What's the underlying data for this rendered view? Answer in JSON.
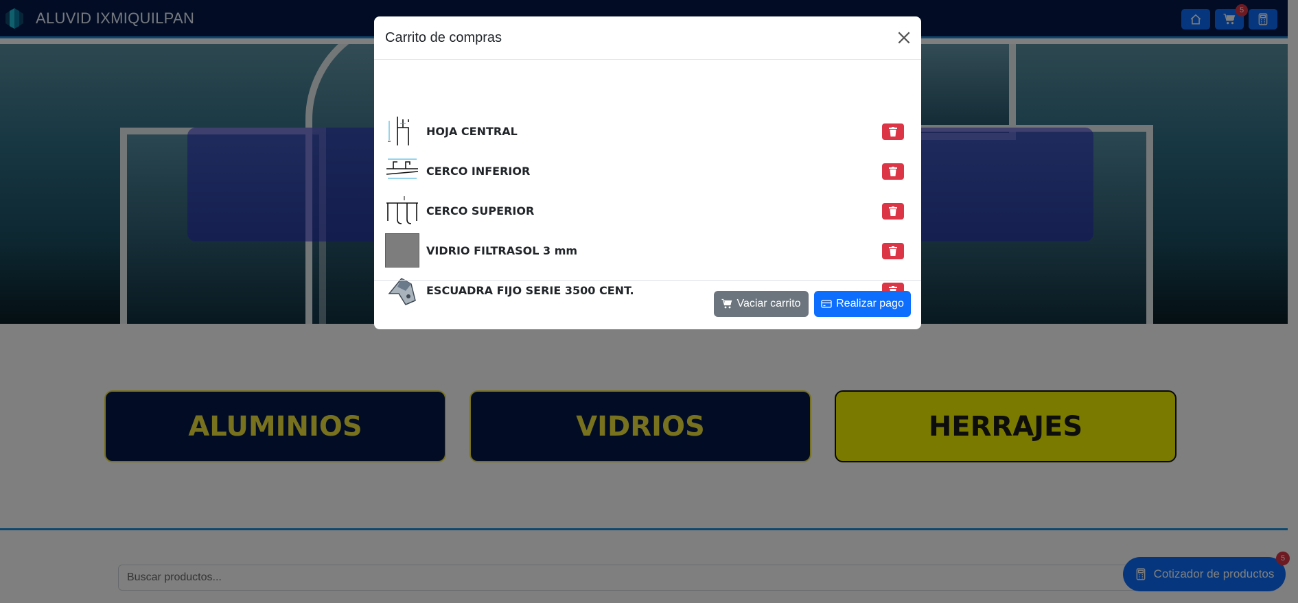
{
  "navbar": {
    "brand": "ALUVID IXMIQUILPAN",
    "cart_count": "5",
    "icons": [
      "home-icon",
      "cart-icon",
      "calculator-icon"
    ]
  },
  "categories": [
    {
      "label": "ALUMINIOS",
      "style": "dark"
    },
    {
      "label": "VIDRIOS",
      "style": "dark"
    },
    {
      "label": "HERRAJES",
      "style": "yellow"
    }
  ],
  "search": {
    "placeholder": "Buscar productos..."
  },
  "quoter": {
    "label": "Cotizador de productos",
    "badge": "5"
  },
  "modal": {
    "title": "Carrito de compras",
    "items": [
      {
        "name": "HOJA CENTRAL",
        "thumb": "profile-drawing"
      },
      {
        "name": "CERCO INFERIOR",
        "thumb": "profile-drawing"
      },
      {
        "name": "CERCO SUPERIOR",
        "thumb": "profile-drawing"
      },
      {
        "name": "VIDRIO FILTRASOL 3 mm",
        "thumb": "glass-swatch"
      },
      {
        "name": "ESCUADRA FIJO SERIE 3500 CENT.",
        "thumb": "bracket-photo"
      }
    ],
    "empty_label": "Vaciar carrito",
    "pay_label": "Realizar pago"
  },
  "colors": {
    "navbar": "#051a4a",
    "accent_blue": "#0d6efd",
    "danger": "#dc3545",
    "category_text": "#f0e23a",
    "category_highlight": "#f5f500"
  }
}
